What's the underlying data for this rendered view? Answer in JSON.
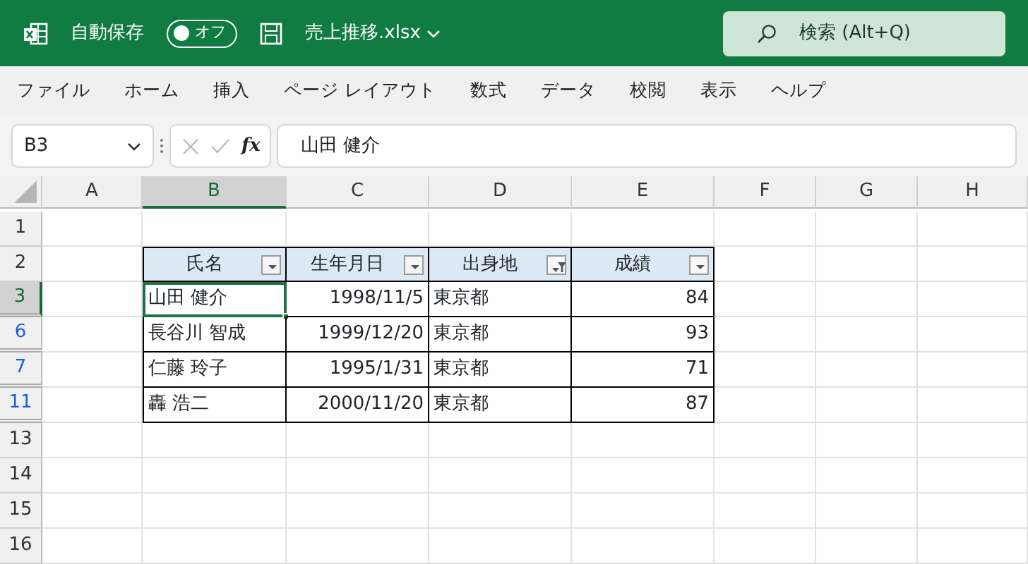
{
  "title_bar": {
    "autosave_label": "自動保存",
    "autosave_toggle": {
      "label": "オフ",
      "on": false
    },
    "file_name": "売上推移.xlsx",
    "search": {
      "placeholder": "検索 (Alt+Q)"
    }
  },
  "menu_tabs": [
    "ファイル",
    "ホーム",
    "挿入",
    "ページ レイアウト",
    "数式",
    "データ",
    "校閲",
    "表示",
    "ヘルプ"
  ],
  "formula_bar": {
    "name_box": "B3",
    "function_label": "fx",
    "formula": "山田 健介"
  },
  "columns": [
    {
      "label": "A",
      "selected": false
    },
    {
      "label": "B",
      "selected": true
    },
    {
      "label": "C",
      "selected": false
    },
    {
      "label": "D",
      "selected": false
    },
    {
      "label": "E",
      "selected": false
    },
    {
      "label": "F",
      "selected": false
    },
    {
      "label": "G",
      "selected": false
    },
    {
      "label": "H",
      "selected": false
    }
  ],
  "rows": [
    {
      "number": "1",
      "filtered": false,
      "selected": false
    },
    {
      "number": "2",
      "filtered": false,
      "selected": false
    },
    {
      "number": "3",
      "filtered": true,
      "selected": true
    },
    {
      "number": "6",
      "filtered": true,
      "selected": false
    },
    {
      "number": "7",
      "filtered": true,
      "selected": false
    },
    {
      "number": "11",
      "filtered": true,
      "selected": false
    },
    {
      "number": "13",
      "filtered": false,
      "selected": false
    },
    {
      "number": "14",
      "filtered": false,
      "selected": false
    },
    {
      "number": "15",
      "filtered": false,
      "selected": false
    },
    {
      "number": "16",
      "filtered": false,
      "selected": false
    }
  ],
  "table": {
    "headers": [
      {
        "label": "氏名",
        "filter_applied": false
      },
      {
        "label": "生年月日",
        "filter_applied": false
      },
      {
        "label": "出身地",
        "filter_applied": true
      },
      {
        "label": "成績",
        "filter_applied": false
      }
    ],
    "rows": [
      {
        "cells": [
          "山田 健介",
          "1998/11/5",
          "東京都",
          "84"
        ],
        "active": true
      },
      {
        "cells": [
          "長谷川 智成",
          "1999/12/20",
          "東京都",
          "93"
        ],
        "active": false
      },
      {
        "cells": [
          "仁藤 玲子",
          "1995/1/31",
          "東京都",
          "71"
        ],
        "active": false
      },
      {
        "cells": [
          "轟 浩二",
          "2000/11/20",
          "東京都",
          "87"
        ],
        "active": false
      }
    ]
  }
}
